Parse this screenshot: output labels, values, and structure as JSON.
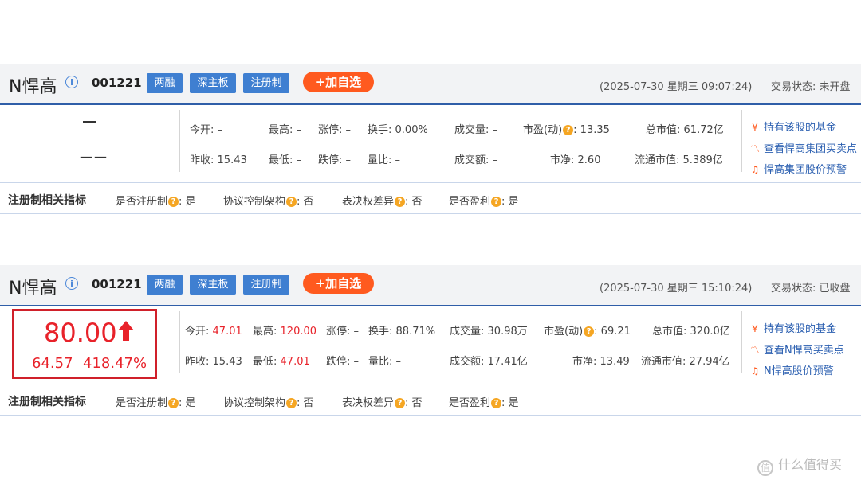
{
  "panels": [
    {
      "stock_name": "N悍高",
      "code": "001221",
      "tags": [
        "两融",
        "深主板",
        "注册制"
      ],
      "add_label": "+加自选",
      "time": "(2025-07-30 星期三 09:07:24)",
      "status": "交易状态: 未开盘",
      "price": "",
      "change": "",
      "change_pct": "",
      "pct_dash": "——",
      "stats": {
        "open": {
          "label": "今开:",
          "value": "–"
        },
        "high": {
          "label": "最高:",
          "value": "–"
        },
        "limit_up": {
          "label": "涨停:",
          "value": "–"
        },
        "turnover": {
          "label": "换手:",
          "value": "0.00%"
        },
        "volume": {
          "label": "成交量:",
          "value": "–"
        },
        "pe": {
          "label": "市盈(动)",
          "value": "13.35"
        },
        "mktcap": {
          "label": "总市值:",
          "value": "61.72亿"
        },
        "prev_close": {
          "label": "昨收:",
          "value": "15.43"
        },
        "low": {
          "label": "最低:",
          "value": "–"
        },
        "limit_down": {
          "label": "跌停:",
          "value": "–"
        },
        "vol_ratio": {
          "label": "量比:",
          "value": "–"
        },
        "amount": {
          "label": "成交额:",
          "value": "–"
        },
        "pb": {
          "label": "市净:",
          "value": "2.60"
        },
        "float_cap": {
          "label": "流通市值:",
          "value": "5.389亿"
        }
      },
      "links": [
        "持有该股的基金",
        "查看悍高集团买卖点",
        "悍高集团股价预警"
      ],
      "register": {
        "title": "注册制相关指标",
        "items": [
          {
            "label": "是否注册制",
            "value": "是"
          },
          {
            "label": "协议控制架构",
            "value": "否"
          },
          {
            "label": "表决权差异",
            "value": "否"
          },
          {
            "label": "是否盈利",
            "value": "是"
          }
        ]
      }
    },
    {
      "stock_name": "N悍高",
      "code": "001221",
      "tags": [
        "两融",
        "深主板",
        "注册制"
      ],
      "add_label": "+加自选",
      "time": "(2025-07-30 星期三 15:10:24)",
      "status": "交易状态: 已收盘",
      "price": "80.00",
      "change": "64.57",
      "change_pct": "418.47%",
      "stats": {
        "open": {
          "label": "今开:",
          "value": "47.01"
        },
        "high": {
          "label": "最高:",
          "value": "120.00"
        },
        "limit_up": {
          "label": "涨停:",
          "value": "–"
        },
        "turnover": {
          "label": "换手:",
          "value": "88.71%"
        },
        "volume": {
          "label": "成交量:",
          "value": "30.98万"
        },
        "pe": {
          "label": "市盈(动)",
          "value": "69.21"
        },
        "mktcap": {
          "label": "总市值:",
          "value": "320.0亿"
        },
        "prev_close": {
          "label": "昨收:",
          "value": "15.43"
        },
        "low": {
          "label": "最低:",
          "value": "47.01"
        },
        "limit_down": {
          "label": "跌停:",
          "value": "–"
        },
        "vol_ratio": {
          "label": "量比:",
          "value": "–"
        },
        "amount": {
          "label": "成交额:",
          "value": "17.41亿"
        },
        "pb": {
          "label": "市净:",
          "value": "13.49"
        },
        "float_cap": {
          "label": "流通市值:",
          "value": "27.94亿"
        }
      },
      "links": [
        "持有该股的基金",
        "查看N悍高买卖点",
        "N悍高股价预警"
      ],
      "register": {
        "title": "注册制相关指标",
        "items": [
          {
            "label": "是否注册制",
            "value": "是"
          },
          {
            "label": "协议控制架构",
            "value": "否"
          },
          {
            "label": "表决权差异",
            "value": "否"
          },
          {
            "label": "是否盈利",
            "value": "是"
          }
        ]
      }
    }
  ],
  "icons": {
    "info": "info-icon",
    "question": "question-icon",
    "yen": "yen-icon",
    "chart": "chart-icon",
    "bell": "bell-icon",
    "arrow": "arrow-up-icon"
  },
  "colors": {
    "up": "#e8222a",
    "tag_bg": "#3f7fd1",
    "add_bg": "#ff5a1f",
    "header_line": "#2f5ea8"
  },
  "watermark": "什么值得买"
}
